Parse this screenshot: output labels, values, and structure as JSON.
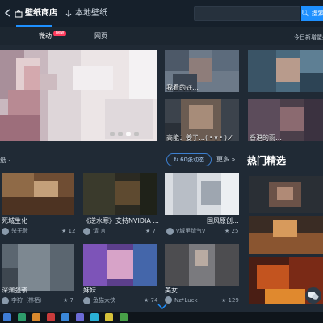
{
  "topbar": {
    "tabs": [
      {
        "label": "壁纸商店",
        "active": true
      },
      {
        "label": "本地壁纸",
        "active": false
      }
    ],
    "search_placeholder": "",
    "search_button": "搜索"
  },
  "subtabs": [
    {
      "label": "微动",
      "active": true,
      "badge": "new"
    },
    {
      "label": "网页",
      "active": false
    }
  ],
  "daily_update": "今日新增壁纸",
  "top_right_tiles": [
    {
      "caption": "我看的好…"
    },
    {
      "caption": ""
    },
    {
      "caption": "高能：姜了…(・v・)ノ"
    },
    {
      "caption": "香港的雨…"
    }
  ],
  "section": {
    "left_label": "纸 -",
    "dynamic_button": "60张动态",
    "more": "更多 »",
    "hot_title": "热门精选"
  },
  "cards": [
    {
      "title": "死城生化",
      "author": "杀无赦",
      "likes": "12"
    },
    {
      "title": "《逆水寒》支持NVIDIA ...",
      "author": "请 言",
      "likes": "7"
    },
    {
      "title": "国风原创...",
      "author": "v城里缝气v",
      "likes": "25"
    },
    {
      "title": "深渊强袭",
      "author": "李狩（林栖）",
      "likes": "7"
    },
    {
      "title": "妹妹",
      "author": "鱼猫大侠",
      "likes": "74"
    },
    {
      "title": "美女",
      "author": "Nz*Luck",
      "likes": "129"
    }
  ],
  "colors": {
    "accent": "#1e90ff",
    "badge": "#ff3b5c",
    "background": "#202a35"
  }
}
